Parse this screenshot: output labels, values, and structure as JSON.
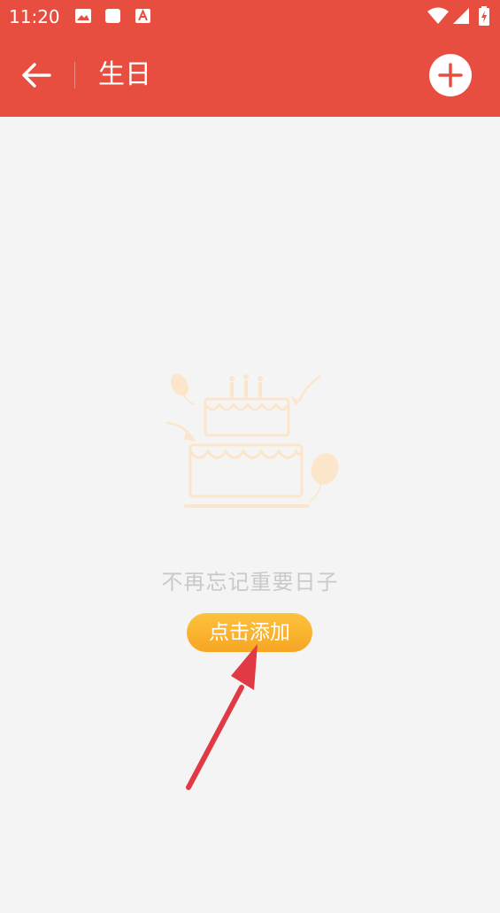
{
  "status_bar": {
    "time": "11:20",
    "icons": [
      "image-icon",
      "square-icon",
      "a-icon",
      "wifi-icon",
      "signal-icon",
      "battery-charging-icon"
    ]
  },
  "app_bar": {
    "title": "生日",
    "back_icon": "arrow-left-icon",
    "add_icon": "plus-icon",
    "background_color": "#e84e40"
  },
  "empty_state": {
    "illustration": "birthday-cake-icon",
    "message": "不再忘记重要日子",
    "button_label": "点击添加",
    "button_color": "#f8b02c"
  },
  "annotation": {
    "arrow_color": "#e03a44"
  }
}
